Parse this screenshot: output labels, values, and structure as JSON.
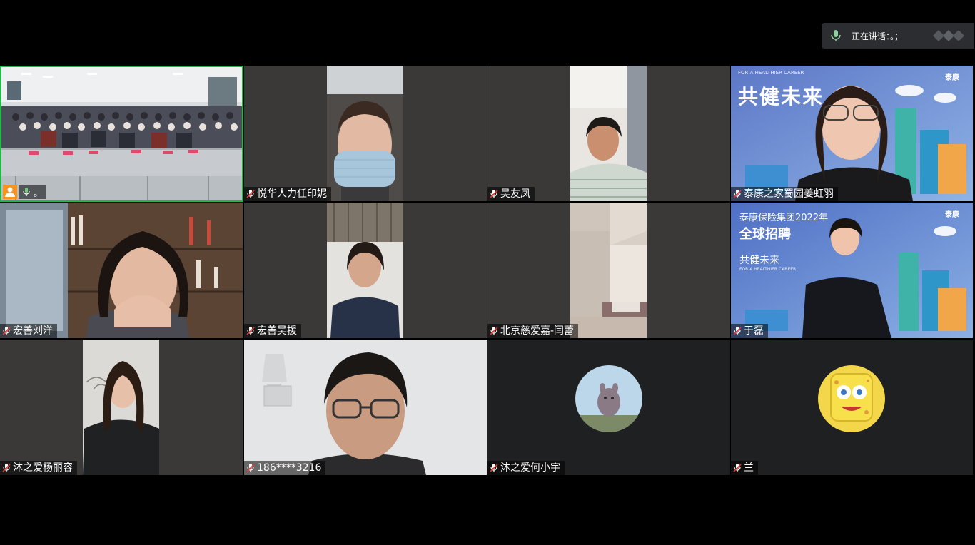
{
  "speaking": {
    "label": "正在讲话：。；"
  },
  "tiles": [
    {
      "name": "。"
    },
    {
      "name": "悦华人力任印妮"
    },
    {
      "name": "吴友凤"
    },
    {
      "name": "泰康之家蜀园姜虹羽",
      "bg_title": "共健未来",
      "bg_top": "FOR A HEALTHIER CAREER",
      "bg_logo": "泰康"
    },
    {
      "name": "宏善刘洋"
    },
    {
      "name": "宏善吴援"
    },
    {
      "name": "北京慈爱嘉-闫蕾"
    },
    {
      "name": "于磊",
      "bg_line1": "泰康保险集团2022年",
      "bg_line2": "全球招聘",
      "bg_line3": "共健未来",
      "bg_small": "FOR A HEALTHIER CAREER",
      "bg_logo": "泰康"
    },
    {
      "name": "沐之爱杨丽容"
    },
    {
      "name": "186****3216"
    },
    {
      "name": "沐之爱何小宇"
    },
    {
      "name": "兰"
    }
  ],
  "colors": {
    "active_border": "#29b34b",
    "host_badge": "#f7931e",
    "tile_bg": "#1f2022"
  }
}
